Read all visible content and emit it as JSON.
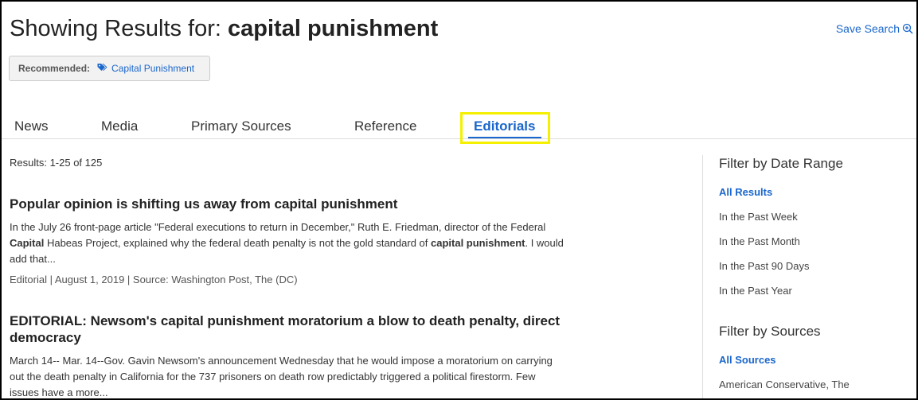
{
  "header": {
    "title_prefix": "Showing Results for: ",
    "title_query": "capital punishment",
    "save_search": "Save Search"
  },
  "recommended": {
    "label": "Recommended:",
    "link": "Capital Punishment"
  },
  "tabs": [
    {
      "label": "News"
    },
    {
      "label": "Media"
    },
    {
      "label": "Primary Sources"
    },
    {
      "label": "Reference"
    },
    {
      "label": "Editorials"
    }
  ],
  "active_tab": "Editorials",
  "results_count": "Results: 1-25 of 125",
  "results": [
    {
      "title": [
        {
          "text": "Popular opinion is shifting us away from ",
          "bold": false
        },
        {
          "text": "capital punishment",
          "bold": true
        }
      ],
      "snippet": [
        {
          "text": "In the July 26 front-page article \"Federal executions to return in December,\" Ruth E. Friedman, director of the Federal ",
          "bold": false
        },
        {
          "text": "Capital",
          "bold": true
        },
        {
          "text": " Habeas Project, explained why the federal death penalty is not the gold standard of ",
          "bold": false
        },
        {
          "text": "capital punishment",
          "bold": true
        },
        {
          "text": ". I would add that...",
          "bold": false
        }
      ],
      "meta": "Editorial | August 1, 2019 | Source: Washington Post, The (DC)"
    },
    {
      "title": [
        {
          "text": "EDITORIAL: Newsom's ",
          "bold": false
        },
        {
          "text": "capital punishment",
          "bold": true
        },
        {
          "text": " moratorium a blow to death penalty, direct democracy",
          "bold": false
        }
      ],
      "snippet": [
        {
          "text": "March 14-- Mar. 14--Gov. Gavin Newsom's announcement Wednesday that he would impose a moratorium on carrying out the death penalty in California for the 737 prisoners on death row predictably triggered a political firestorm. Few issues have a more...",
          "bold": false
        }
      ],
      "meta": ""
    }
  ],
  "sidebar": {
    "date_heading": "Filter by Date Range",
    "date_filters": [
      {
        "label": "All Results",
        "active": true
      },
      {
        "label": "In the Past Week",
        "active": false
      },
      {
        "label": "In the Past Month",
        "active": false
      },
      {
        "label": "In the Past 90 Days",
        "active": false
      },
      {
        "label": "In the Past Year",
        "active": false
      }
    ],
    "sources_heading": "Filter by Sources",
    "source_filters": [
      {
        "label": "All Sources",
        "active": true
      },
      {
        "label": "American Conservative, The",
        "active": false
      }
    ]
  },
  "colors": {
    "link": "#1a66cc",
    "highlight": "#f5f000"
  }
}
